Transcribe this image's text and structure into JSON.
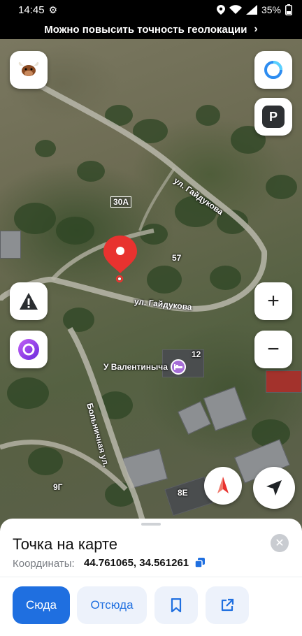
{
  "status_bar": {
    "time": "14:45",
    "battery": "35%",
    "settings_icon": "gear-icon",
    "icons": [
      "location-icon",
      "wifi-icon",
      "signal-icon",
      "battery-icon"
    ]
  },
  "banner": {
    "text": "Можно повысить точность геолокации",
    "chevron": "›"
  },
  "map": {
    "street_labels": [
      "ул. Гайдукова",
      "ул. Гайдукова",
      "Больничная ул."
    ],
    "house_numbers": [
      "30А",
      "57",
      "12",
      "9Г",
      "8Е"
    ],
    "poi_label": "У Валентиныча",
    "buttons": {
      "profile_icon": "bull-avatar-icon",
      "alice_icon": "alice-icon",
      "parking_label": "P",
      "warning_icon": "road-event-icon",
      "zoom_in": "+",
      "zoom_out": "−",
      "compass_icon": "compass-icon",
      "locate_icon": "my-location-arrow-icon"
    },
    "colors": {
      "pin": "#e8322f",
      "accent": "#1f6fe0"
    }
  },
  "sheet": {
    "title": "Точка на карте",
    "coords_label": "Координаты:",
    "coords_value": "44.761065, 34.561261",
    "actions": {
      "here": "Сюда",
      "from_here": "Отсюда",
      "bookmark_icon": "bookmark-icon",
      "share_icon": "share-icon"
    },
    "close": "✕"
  }
}
